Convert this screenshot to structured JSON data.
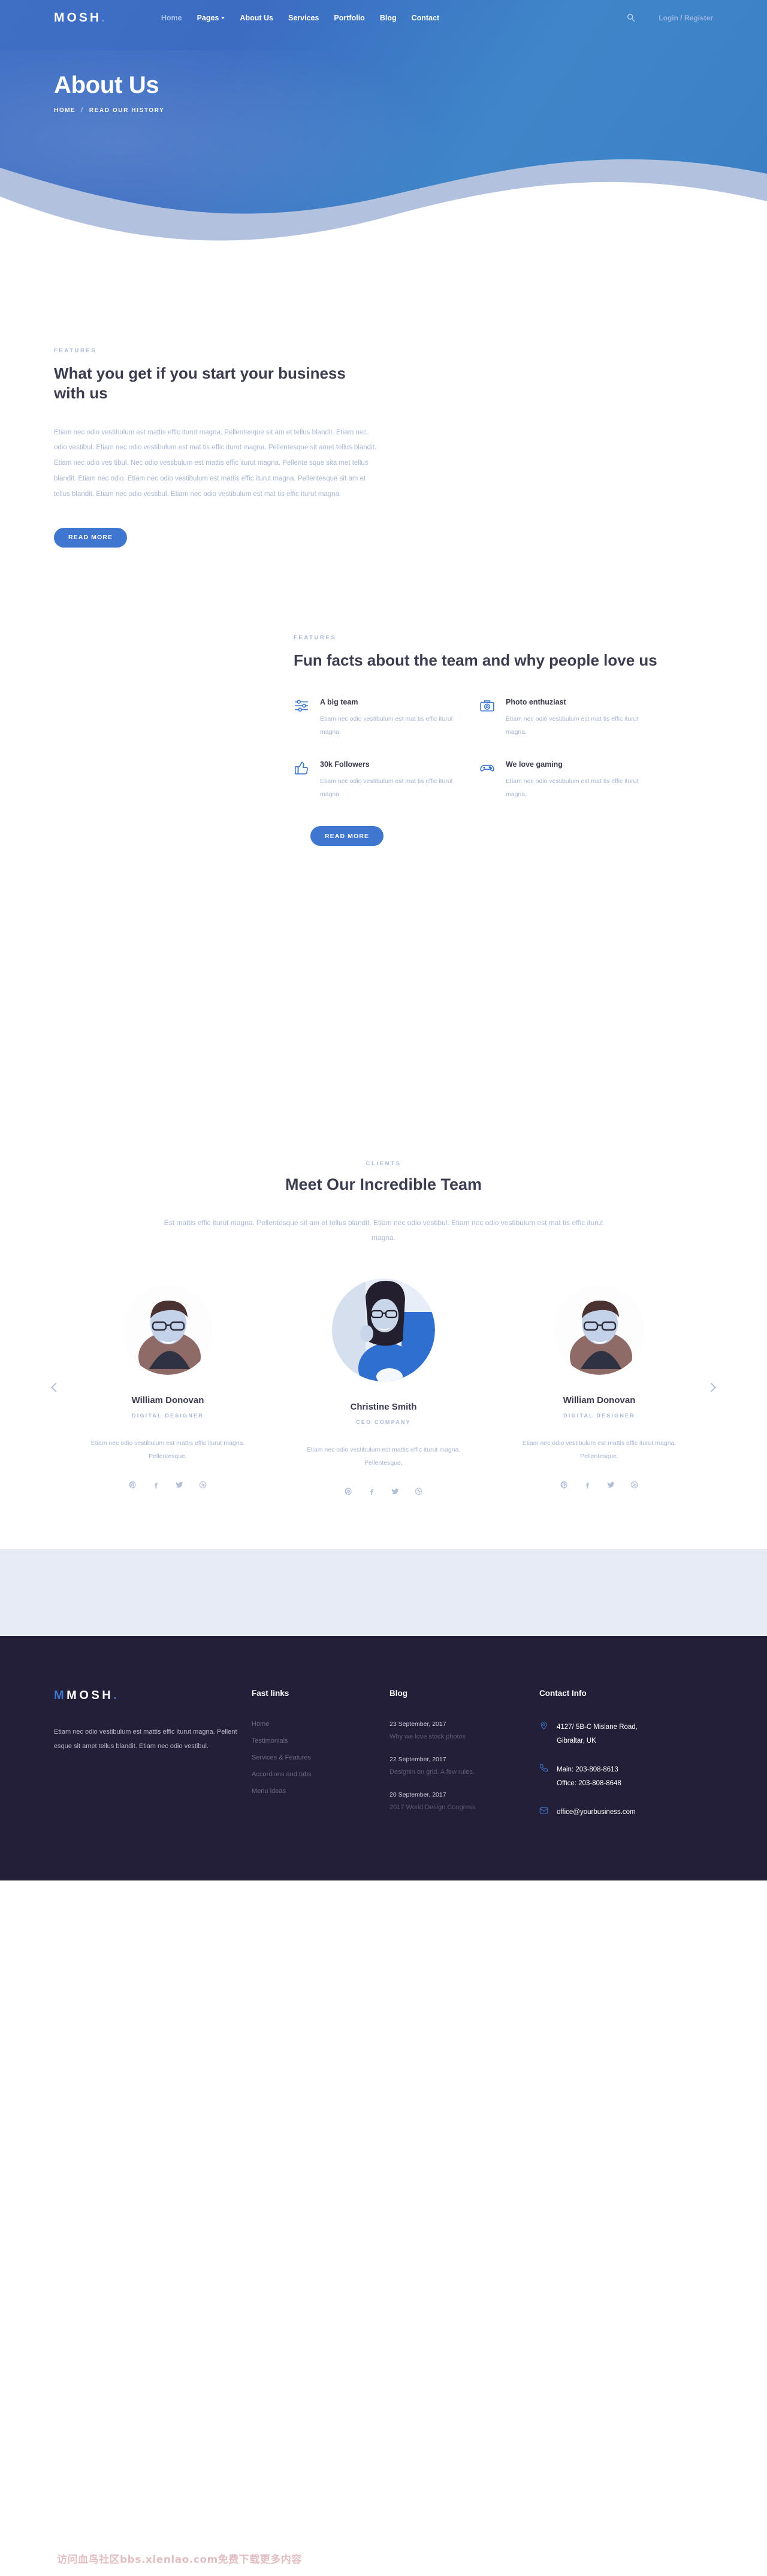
{
  "brand": {
    "name": "MOSH",
    "dot": "."
  },
  "nav": {
    "items": [
      {
        "label": "Home",
        "active": true,
        "caret": false
      },
      {
        "label": "Pages",
        "active": false,
        "caret": true
      },
      {
        "label": "About Us",
        "active": false,
        "caret": false
      },
      {
        "label": "Services",
        "active": false,
        "caret": false
      },
      {
        "label": "Portfolio",
        "active": false,
        "caret": false
      },
      {
        "label": "Blog",
        "active": false,
        "caret": false
      },
      {
        "label": "Contact",
        "active": false,
        "caret": false
      }
    ],
    "search_icon": "search-icon",
    "login": "Login / Register"
  },
  "hero": {
    "title": "About Us",
    "breadcrumb_home": "HOME",
    "breadcrumb_sep": "/",
    "breadcrumb_current": "READ OUR HISTORY"
  },
  "section1": {
    "eyebrow": "FEATURES",
    "heading": "What you get if you start your business with us",
    "body": "Etiam nec odio vestibulum est mattis effic iturut magna. Pellentesque sit am et tellus blandit. Etiam nec odio vestibul. Etiam nec odio vestibulum est mat tis effic iturut magna. Pellentesque sit amet tellus blandit. Etiam nec odio ves tibul. Nec odio vestibulum est mattis effic iturut magna. Pellente sque sita met tellus blandit. Etiam nec odio. Etiam nec odio vestibulum est mattis effic iturut magna. Pellentesque sit am et tellus blandit. Etiam nec odio vestibul. Etiam nec odio vestibulum est mat tis effic iturut magna.",
    "button": "READ MORE"
  },
  "section2": {
    "eyebrow": "FEATURES",
    "heading": "Fun facts about the team and why people love us",
    "button": "READ MORE",
    "features": [
      {
        "icon": "sliders-icon",
        "title": "A big team",
        "text": "Etiam nec odio vestibulum est mat tis effic iturut magna."
      },
      {
        "icon": "camera-icon",
        "title": "Photo enthuziast",
        "text": "Etiam nec odio vestibulum est mat tis effic iturut magna."
      },
      {
        "icon": "thumbs-up-icon",
        "title": "30k Followers",
        "text": "Etiam nec odio vestibulum est mat tis effic iturut magna."
      },
      {
        "icon": "gamepad-icon",
        "title": "We love gaming",
        "text": "Etiam nec odio vestibulum est mat tis effic iturut magna."
      }
    ]
  },
  "team": {
    "eyebrow": "CLIENTS",
    "heading": "Meet Our Incredible Team",
    "subtitle": "Est mattis effic iturut magna. Pellentesque sit am et tellus blandit. Etiam nec odio vestibul. Etiam nec odio vestibulum est mat tis effic iturut magna.",
    "prev_icon": "chevron-left-icon",
    "next_icon": "chevron-right-icon",
    "members": [
      {
        "name": "William Donovan",
        "role": "DIGITAL DESIGNER",
        "text": "Etiam nec odio vestibulum est mattis effic iturut magna. Pellentesque.",
        "featured": false
      },
      {
        "name": "Christine Smith",
        "role": "CEO COMPANY",
        "text": "Etiam nec odio vestibulum est mattis effic iturut magna. Pellentesque.",
        "featured": true
      },
      {
        "name": "William Donovan",
        "role": "DIGITAL DESIGNER",
        "text": "Etiam nec odio vestibulum est mattis effic iturut magna. Pellentesque.",
        "featured": false
      }
    ],
    "socials": [
      "pinterest-icon",
      "facebook-icon",
      "twitter-icon",
      "dribbble-icon"
    ]
  },
  "footer": {
    "brand": "MOSH",
    "about": "Etiam nec odio vestibulum est mattis effic iturut magna. Pellent esque sit amet tellus blandit. Etiam nec odio vestibul.",
    "fastlinks_title": "Fast links",
    "fastlinks": [
      "Home",
      "Testimonials",
      "Services & Features",
      "Accordions and tabs",
      "Menu ideas"
    ],
    "blog_title": "Blog",
    "blog": [
      {
        "date": "23 September, 2017",
        "title": "Why we love stock photos"
      },
      {
        "date": "22 September, 2017",
        "title": "Designin on grid. A few rules."
      },
      {
        "date": "20 September, 2017",
        "title": "2017 World Design Congress"
      }
    ],
    "contact_title": "Contact Info",
    "contacts": [
      {
        "icon": "location-icon",
        "line1": "4127/ 5B-C Mislane Road,",
        "line2": "Gibraltar, UK"
      },
      {
        "icon": "phone-icon",
        "line1": "Main: 203-808-8613",
        "line2": "Office: 203-808-8648"
      },
      {
        "icon": "mail-icon",
        "line1": "office@yourbusiness.com",
        "line2": ""
      }
    ]
  },
  "watermark": "访问血鸟社区bbs.xlenlao.com免费下载更多内容",
  "colors": {
    "accent": "#3f76d0",
    "hero_blue": "#3c6cc2",
    "footer_bg": "#231f38",
    "muted": "#a9b6d6",
    "strip": "#e7ebf6"
  }
}
